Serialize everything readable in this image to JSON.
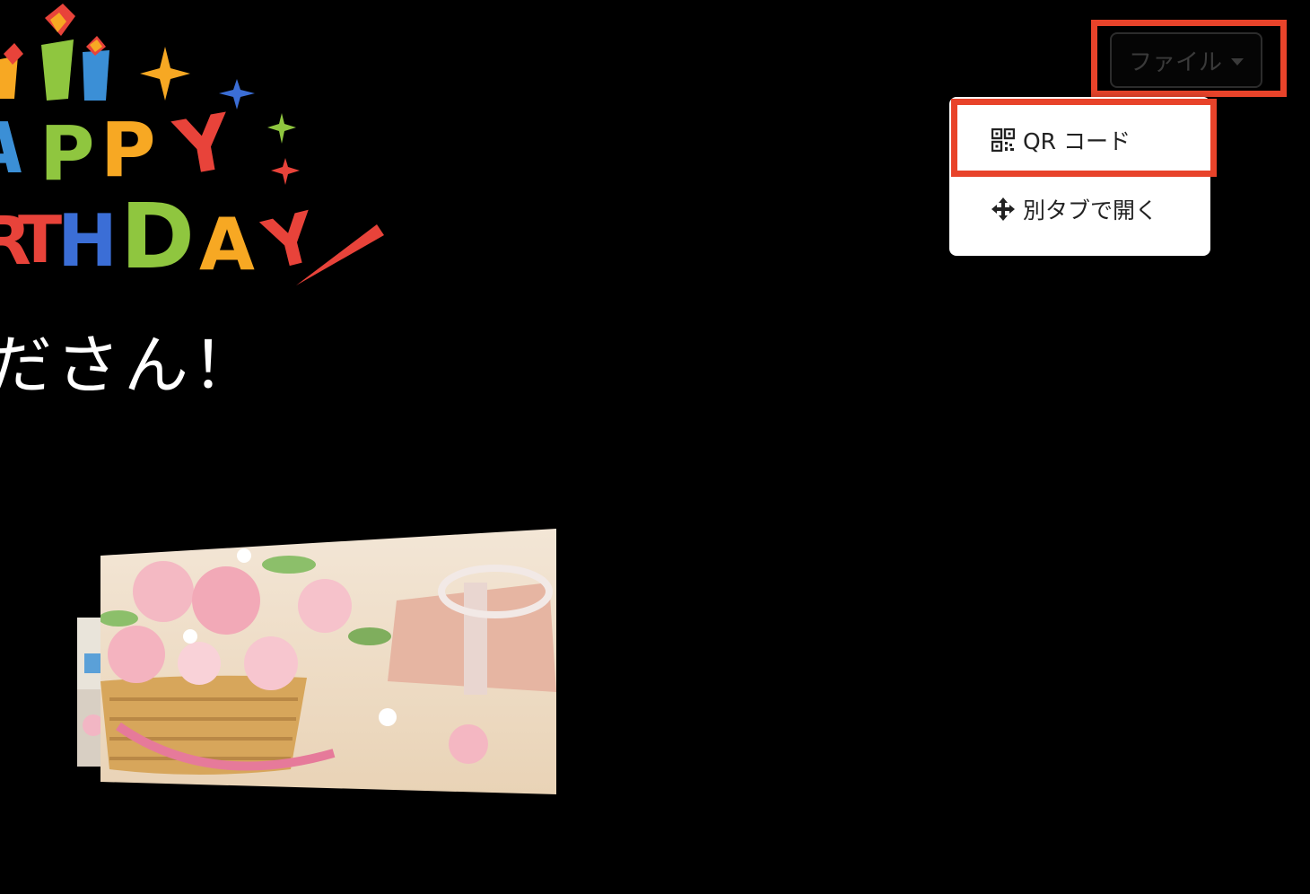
{
  "logo": {
    "line1": "APPY",
    "line2": "THDAY"
  },
  "greeting": "ださん！",
  "file_menu": {
    "button_label": "ファイル",
    "items": [
      {
        "label": "QR コード",
        "icon": "qr-code-icon"
      },
      {
        "label": "別タブで開く",
        "icon": "move-arrows-icon"
      }
    ]
  },
  "colors": {
    "background": "#000000",
    "highlight": "#e8432a",
    "menu_bg": "#ffffff",
    "menu_text": "#222222"
  }
}
